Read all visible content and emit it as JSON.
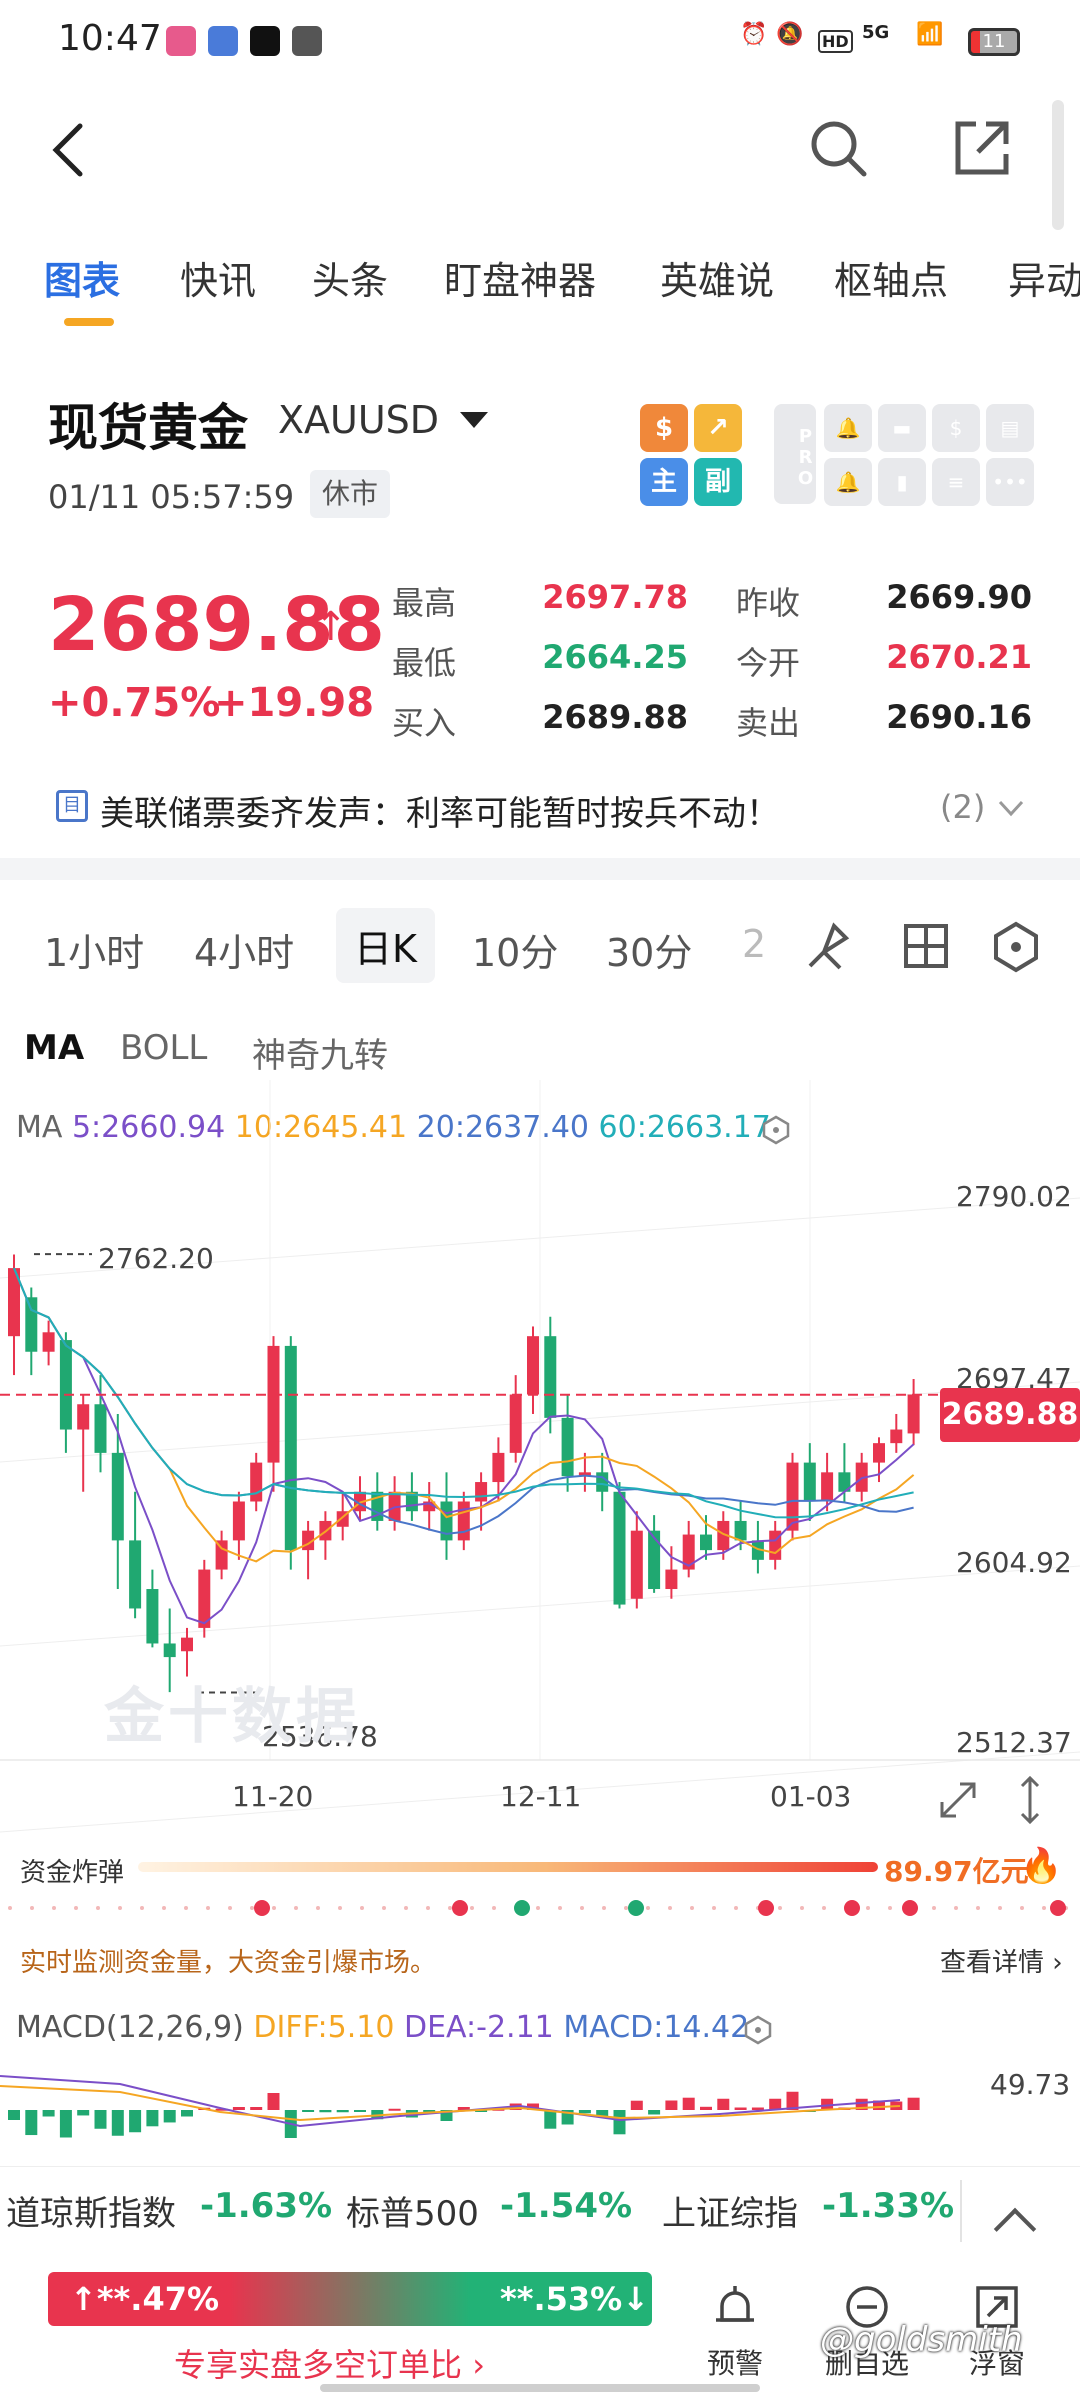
{
  "status_bar": {
    "time": "10:47",
    "network": "5G",
    "battery": "11"
  },
  "nav": {
    "back_icon": "back-arrow-icon",
    "search_icon": "search-icon",
    "share_icon": "share-icon"
  },
  "tabs": [
    {
      "label": "图表",
      "active": true
    },
    {
      "label": "快讯"
    },
    {
      "label": "头条"
    },
    {
      "label": "盯盘神器"
    },
    {
      "label": "英雄说"
    },
    {
      "label": "枢轴点"
    },
    {
      "label": "异动"
    }
  ],
  "instrument": {
    "name": "现货黄金",
    "symbol": "XAUUSD",
    "datetime": "01/11 05:57:59",
    "market_status": "休市",
    "quick_buttons": [
      "$",
      "↗",
      "主",
      "副"
    ],
    "pro_label": "PRO"
  },
  "quote": {
    "price": "2689.88",
    "change_pct": "+0.75%",
    "change_abs": "+19.98",
    "stats": [
      {
        "label": "最高",
        "value": "2697.78",
        "color": "#e8344e"
      },
      {
        "label": "昨收",
        "value": "2669.90",
        "color": "#222222"
      },
      {
        "label": "最低",
        "value": "2664.25",
        "color": "#20a871"
      },
      {
        "label": "今开",
        "value": "2670.21",
        "color": "#e8344e"
      },
      {
        "label": "买入",
        "value": "2689.88",
        "color": "#222222"
      },
      {
        "label": "卖出",
        "value": "2690.16",
        "color": "#222222"
      }
    ]
  },
  "news": {
    "text": "美联储票委齐发声：利率可能暂时按兵不动！",
    "count": "(2)"
  },
  "periods": [
    "1小时",
    "4小时",
    "日K",
    "10分",
    "30分",
    "2"
  ],
  "indicator_tabs": [
    "MA",
    "BOLL",
    "神奇九转"
  ],
  "ma": {
    "prefix": "MA",
    "ma5": "5:2660.94",
    "ma10": "10:2645.41",
    "ma20": "20:2637.40",
    "ma60": "60:2663.17"
  },
  "chart_data": {
    "type": "candlestick",
    "y_axis_labels": [
      "2790.02",
      "2697.47",
      "2604.92",
      "2512.37"
    ],
    "x_axis_labels": [
      "11-20",
      "12-11",
      "01-03"
    ],
    "current_price_tag": "2689.88",
    "annotations": {
      "high_marker": "2762.20",
      "low_marker": "2536.78"
    },
    "watermark": "金十数据",
    "candles": [
      {
        "o": 2720,
        "h": 2762,
        "l": 2700,
        "c": 2755
      },
      {
        "o": 2740,
        "h": 2745,
        "l": 2700,
        "c": 2712
      },
      {
        "o": 2712,
        "h": 2728,
        "l": 2705,
        "c": 2722
      },
      {
        "o": 2718,
        "h": 2722,
        "l": 2660,
        "c": 2672
      },
      {
        "o": 2672,
        "h": 2690,
        "l": 2640,
        "c": 2685
      },
      {
        "o": 2685,
        "h": 2700,
        "l": 2650,
        "c": 2660
      },
      {
        "o": 2660,
        "h": 2680,
        "l": 2590,
        "c": 2615
      },
      {
        "o": 2615,
        "h": 2640,
        "l": 2575,
        "c": 2580
      },
      {
        "o": 2590,
        "h": 2600,
        "l": 2560,
        "c": 2562
      },
      {
        "o": 2562,
        "h": 2580,
        "l": 2537,
        "c": 2555
      },
      {
        "o": 2558,
        "h": 2570,
        "l": 2545,
        "c": 2565
      },
      {
        "o": 2570,
        "h": 2605,
        "l": 2565,
        "c": 2600
      },
      {
        "o": 2600,
        "h": 2620,
        "l": 2595,
        "c": 2615
      },
      {
        "o": 2615,
        "h": 2640,
        "l": 2605,
        "c": 2635
      },
      {
        "o": 2635,
        "h": 2660,
        "l": 2630,
        "c": 2655
      },
      {
        "o": 2655,
        "h": 2720,
        "l": 2640,
        "c": 2715
      },
      {
        "o": 2715,
        "h": 2720,
        "l": 2600,
        "c": 2610
      },
      {
        "o": 2610,
        "h": 2625,
        "l": 2595,
        "c": 2620
      },
      {
        "o": 2615,
        "h": 2630,
        "l": 2605,
        "c": 2625
      },
      {
        "o": 2622,
        "h": 2640,
        "l": 2615,
        "c": 2630
      },
      {
        "o": 2630,
        "h": 2648,
        "l": 2625,
        "c": 2640
      },
      {
        "o": 2640,
        "h": 2650,
        "l": 2620,
        "c": 2625
      },
      {
        "o": 2625,
        "h": 2648,
        "l": 2620,
        "c": 2640
      },
      {
        "o": 2640,
        "h": 2650,
        "l": 2625,
        "c": 2630
      },
      {
        "o": 2630,
        "h": 2645,
        "l": 2620,
        "c": 2635
      },
      {
        "o": 2635,
        "h": 2650,
        "l": 2605,
        "c": 2615
      },
      {
        "o": 2615,
        "h": 2640,
        "l": 2610,
        "c": 2635
      },
      {
        "o": 2635,
        "h": 2650,
        "l": 2620,
        "c": 2645
      },
      {
        "o": 2645,
        "h": 2668,
        "l": 2635,
        "c": 2660
      },
      {
        "o": 2660,
        "h": 2700,
        "l": 2655,
        "c": 2690
      },
      {
        "o": 2690,
        "h": 2725,
        "l": 2680,
        "c": 2720
      },
      {
        "o": 2720,
        "h": 2730,
        "l": 2670,
        "c": 2678
      },
      {
        "o": 2678,
        "h": 2690,
        "l": 2640,
        "c": 2648
      },
      {
        "o": 2648,
        "h": 2660,
        "l": 2640,
        "c": 2650
      },
      {
        "o": 2650,
        "h": 2660,
        "l": 2630,
        "c": 2640
      },
      {
        "o": 2640,
        "h": 2645,
        "l": 2580,
        "c": 2582
      },
      {
        "o": 2585,
        "h": 2630,
        "l": 2580,
        "c": 2620
      },
      {
        "o": 2620,
        "h": 2628,
        "l": 2588,
        "c": 2590
      },
      {
        "o": 2590,
        "h": 2612,
        "l": 2585,
        "c": 2600
      },
      {
        "o": 2600,
        "h": 2625,
        "l": 2596,
        "c": 2618
      },
      {
        "o": 2618,
        "h": 2628,
        "l": 2605,
        "c": 2610
      },
      {
        "o": 2610,
        "h": 2630,
        "l": 2605,
        "c": 2625
      },
      {
        "o": 2625,
        "h": 2635,
        "l": 2610,
        "c": 2615
      },
      {
        "o": 2615,
        "h": 2625,
        "l": 2598,
        "c": 2605
      },
      {
        "o": 2605,
        "h": 2625,
        "l": 2600,
        "c": 2620
      },
      {
        "o": 2620,
        "h": 2660,
        "l": 2615,
        "c": 2655
      },
      {
        "o": 2655,
        "h": 2665,
        "l": 2625,
        "c": 2635
      },
      {
        "o": 2635,
        "h": 2660,
        "l": 2630,
        "c": 2650
      },
      {
        "o": 2650,
        "h": 2665,
        "l": 2635,
        "c": 2640
      },
      {
        "o": 2640,
        "h": 2660,
        "l": 2635,
        "c": 2655
      },
      {
        "o": 2655,
        "h": 2668,
        "l": 2645,
        "c": 2665
      },
      {
        "o": 2665,
        "h": 2680,
        "l": 2660,
        "c": 2672
      },
      {
        "o": 2670,
        "h": 2698,
        "l": 2664,
        "c": 2690
      }
    ]
  },
  "capital_bomb": {
    "label": "资金炸弹",
    "value": "89.97亿元",
    "desc": "实时监测资金量，大资金引爆市场。",
    "more": "查看详情"
  },
  "macd": {
    "prefix": "MACD(12,26,9)",
    "diff": "DIFF:5.10",
    "dea": "DEA:-2.11",
    "macd": "MACD:14.42",
    "y_label": "49.73"
  },
  "ticker": [
    {
      "name": "道琼斯指数",
      "value": "-1.63%"
    },
    {
      "name": "标普500",
      "value": "-1.54%"
    },
    {
      "name": "上证综指",
      "value": "-1.33%"
    }
  ],
  "bottom": {
    "long_pct": "**.47%",
    "short_pct": "**.53%",
    "promo": "专享实盘多空订单比",
    "buttons": [
      {
        "label": "预警",
        "icon": "alarm-icon"
      },
      {
        "label": "删自选",
        "icon": "remove-watchlist-icon"
      },
      {
        "label": "浮窗",
        "icon": "floating-window-icon"
      }
    ],
    "watermark": "@goldsmith"
  },
  "colors": {
    "up": "#e8344e",
    "down": "#20a871",
    "accent": "#2b6fe2"
  }
}
